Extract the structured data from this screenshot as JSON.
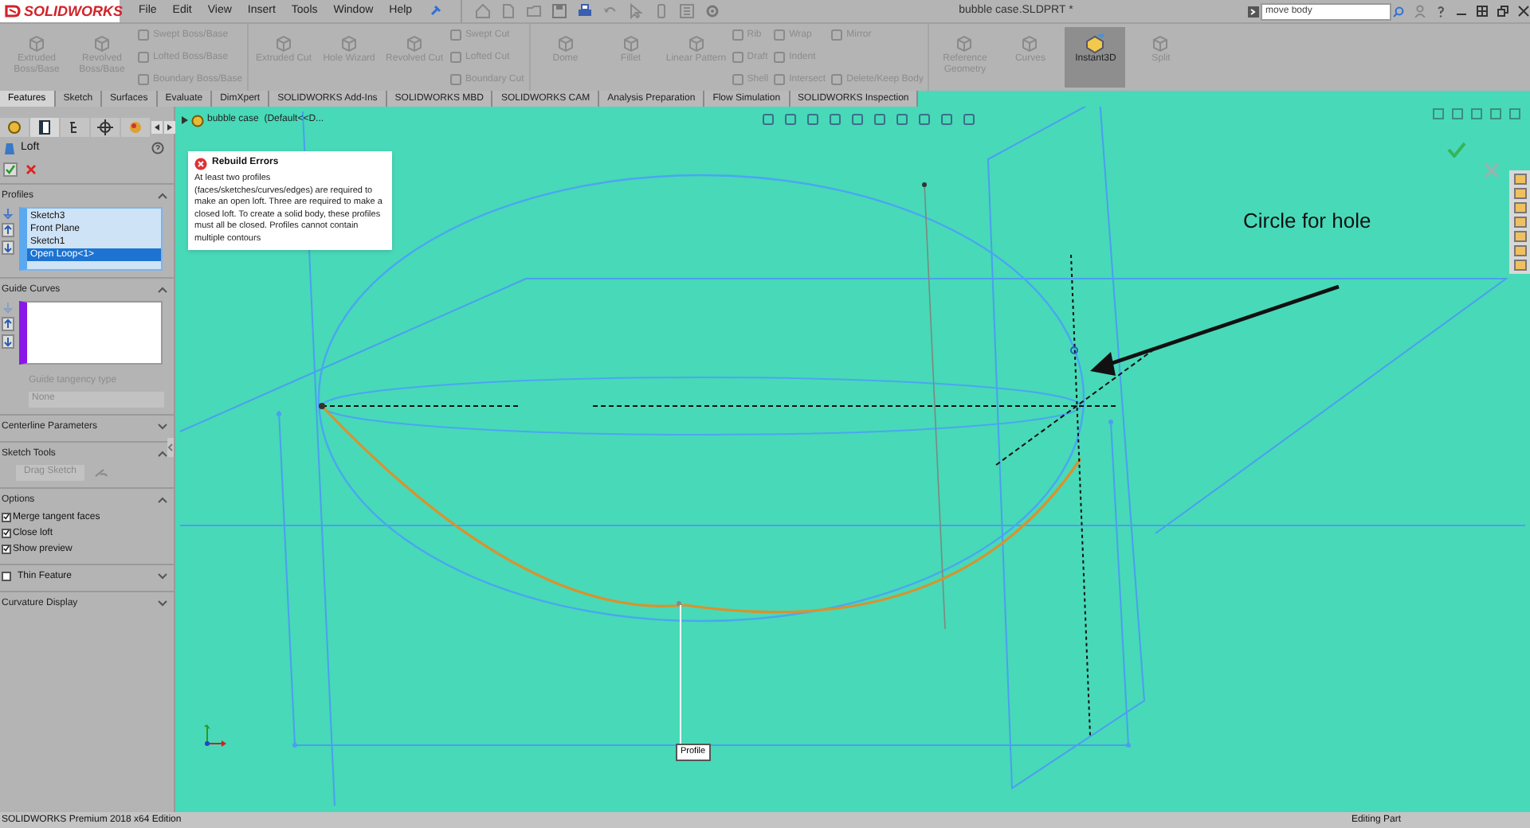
{
  "app": {
    "logo": "SOLIDWORKS",
    "menu": [
      "File",
      "Edit",
      "View",
      "Insert",
      "Tools",
      "Window",
      "Help"
    ],
    "document_title": "bubble case.SLDPRT *",
    "search": {
      "value": "move body"
    }
  },
  "ribbon": {
    "groups": [
      {
        "columns": [
          {
            "kind": "large",
            "label": "Extruded Boss/Base",
            "disabled": true,
            "on": false
          },
          {
            "kind": "large",
            "label": "Revolved Boss/Base",
            "disabled": true,
            "on": false
          },
          {
            "kind": "stack",
            "items": [
              {
                "label": "Swept Boss/Base",
                "disabled": true
              },
              {
                "label": "Lofted Boss/Base",
                "disabled": true
              },
              {
                "label": "Boundary Boss/Base",
                "disabled": true
              }
            ]
          }
        ]
      },
      {
        "columns": [
          {
            "kind": "large",
            "label": "Extruded Cut",
            "disabled": true,
            "on": false
          },
          {
            "kind": "large",
            "label": "Hole Wizard",
            "disabled": true,
            "on": false
          },
          {
            "kind": "large",
            "label": "Revolved Cut",
            "disabled": true,
            "on": false
          },
          {
            "kind": "stack",
            "items": [
              {
                "label": "Swept Cut",
                "disabled": true
              },
              {
                "label": "Lofted Cut",
                "disabled": true
              },
              {
                "label": "Boundary Cut",
                "disabled": true
              }
            ]
          }
        ]
      },
      {
        "columns": [
          {
            "kind": "large",
            "label": "Dome",
            "disabled": true,
            "on": false
          },
          {
            "kind": "large",
            "label": "Fillet",
            "disabled": true,
            "on": false
          },
          {
            "kind": "large",
            "label": "Linear Pattern",
            "disabled": true,
            "on": false
          },
          {
            "kind": "stack",
            "items": [
              {
                "label": "Rib",
                "disabled": true
              },
              {
                "label": "Draft",
                "disabled": true
              },
              {
                "label": "Shell",
                "disabled": true
              }
            ]
          },
          {
            "kind": "stack",
            "items": [
              {
                "label": "Wrap",
                "disabled": true
              },
              {
                "label": "Indent",
                "disabled": true
              },
              {
                "label": "Intersect",
                "disabled": true
              }
            ]
          },
          {
            "kind": "stack",
            "items": [
              {
                "label": "Mirror",
                "disabled": true
              },
              {
                "label": "Delete/Keep Body",
                "disabled": true
              }
            ]
          }
        ]
      },
      {
        "columns": [
          {
            "kind": "large",
            "label": "Reference Geometry",
            "disabled": true,
            "on": false
          },
          {
            "kind": "large",
            "label": "Curves",
            "disabled": true,
            "on": false
          },
          {
            "kind": "large",
            "label": "Instant3D",
            "disabled": false,
            "on": true
          },
          {
            "kind": "large",
            "label": "Split",
            "disabled": true,
            "on": false
          }
        ]
      }
    ]
  },
  "tabs": [
    {
      "label": "Features",
      "selected": true
    },
    {
      "label": "Sketch",
      "selected": false
    },
    {
      "label": "Surfaces",
      "selected": false
    },
    {
      "label": "Evaluate",
      "selected": false
    },
    {
      "label": "DimXpert",
      "selected": false
    },
    {
      "label": "SOLIDWORKS Add-Ins",
      "selected": false
    },
    {
      "label": "SOLIDWORKS MBD",
      "selected": false
    },
    {
      "label": "SOLIDWORKS CAM",
      "selected": false
    },
    {
      "label": "Analysis Preparation",
      "selected": false
    },
    {
      "label": "Flow Simulation",
      "selected": false
    },
    {
      "label": "SOLIDWORKS Inspection",
      "selected": false
    }
  ],
  "property_manager": {
    "title": "Loft",
    "profiles": {
      "heading": "Profiles",
      "items": [
        {
          "label": "Sketch3",
          "selected": false
        },
        {
          "label": "Front Plane",
          "selected": false
        },
        {
          "label": "Sketch1",
          "selected": false
        },
        {
          "label": "Open Loop<1>",
          "selected": true
        }
      ]
    },
    "guide_curves": {
      "heading": "Guide Curves",
      "tangency_label": "Guide tangency type",
      "tangency_value": "None"
    },
    "centerline": {
      "heading": "Centerline Parameters"
    },
    "sketch_tools": {
      "heading": "Sketch Tools",
      "button": "Drag Sketch"
    },
    "options": {
      "heading": "Options",
      "items": [
        {
          "label": "Merge tangent faces",
          "checked": true
        },
        {
          "label": "Close loft",
          "checked": true
        },
        {
          "label": "Show preview",
          "checked": true
        }
      ]
    },
    "thin_feature": {
      "label": "Thin Feature",
      "checked": false
    },
    "curvature": {
      "heading": "Curvature Display"
    }
  },
  "viewport": {
    "tree_item": "bubble case  (Default<<D...",
    "error_popup": {
      "title": "Rebuild Errors",
      "message": "At least two profiles (faces/sketches/curves/edges) are required to make an open loft. Three are required to make a closed loft.  To create a solid body, these profiles must all be closed. Profiles cannot contain multiple contours"
    },
    "annotation": "Circle for hole",
    "callout": "Profile"
  },
  "status_bar": {
    "edition": "SOLIDWORKS Premium 2018 x64 Edition",
    "mode": "Editing Part"
  }
}
